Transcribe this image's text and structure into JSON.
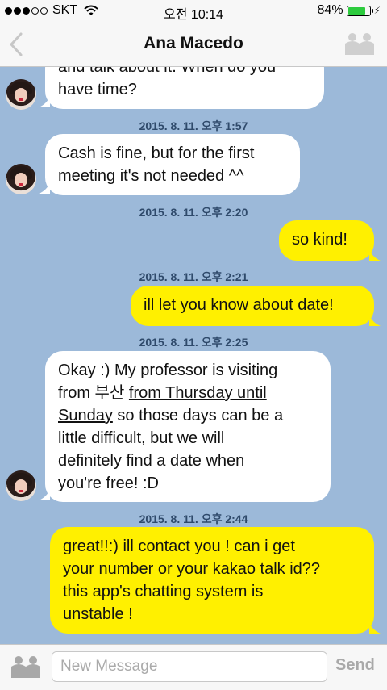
{
  "status_bar": {
    "carrier": "SKT",
    "time": "오전 10:14",
    "battery": "84%",
    "battery_level": 0.84
  },
  "nav": {
    "title": "Ana Macedo",
    "back_icon": "chevron-left-icon",
    "people_icon": "people-icon"
  },
  "messages": [
    {
      "dir": "in",
      "lines": [
        "and talk about it. When do you",
        "have time?"
      ]
    },
    {
      "type": "timestamp",
      "text": "2015. 8. 11. 오후 1:57"
    },
    {
      "dir": "in",
      "lines": [
        "Cash is fine, but for the first",
        "meeting it's not needed ^^"
      ]
    },
    {
      "type": "timestamp",
      "text": "2015. 8. 11. 오후 2:20"
    },
    {
      "dir": "out",
      "text": "so kind!"
    },
    {
      "type": "timestamp",
      "text": "2015. 8. 11. 오후 2:21"
    },
    {
      "dir": "out",
      "text": "ill let you know about date!"
    },
    {
      "type": "timestamp",
      "text": "2015. 8. 11. 오후 2:25"
    },
    {
      "dir": "in",
      "parts": {
        "l1": "Okay :) My professor is visiting",
        "l2a": "from 부산 ",
        "l2b": "from Thursday until",
        "l3a": "Sunday",
        "l3b": " so those days can be a",
        "l4": "little difficult, but we will",
        "l5": "definitely find a date when",
        "l6": "you're free! :D"
      }
    },
    {
      "type": "timestamp",
      "text": "2015. 8. 11. 오후 2:44"
    },
    {
      "dir": "out",
      "lines": [
        "great!!:) ill contact you ! can i get",
        "your number or your kakao talk id??",
        "this app's chatting system is",
        "unstable !"
      ]
    }
  ],
  "input": {
    "placeholder": "New Message",
    "value": "",
    "send_label": "Send"
  },
  "colors": {
    "background": "#9cb9d9",
    "incoming_bubble": "#ffffff",
    "outgoing_bubble": "#fff000",
    "timestamp": "#2f4a6b"
  }
}
